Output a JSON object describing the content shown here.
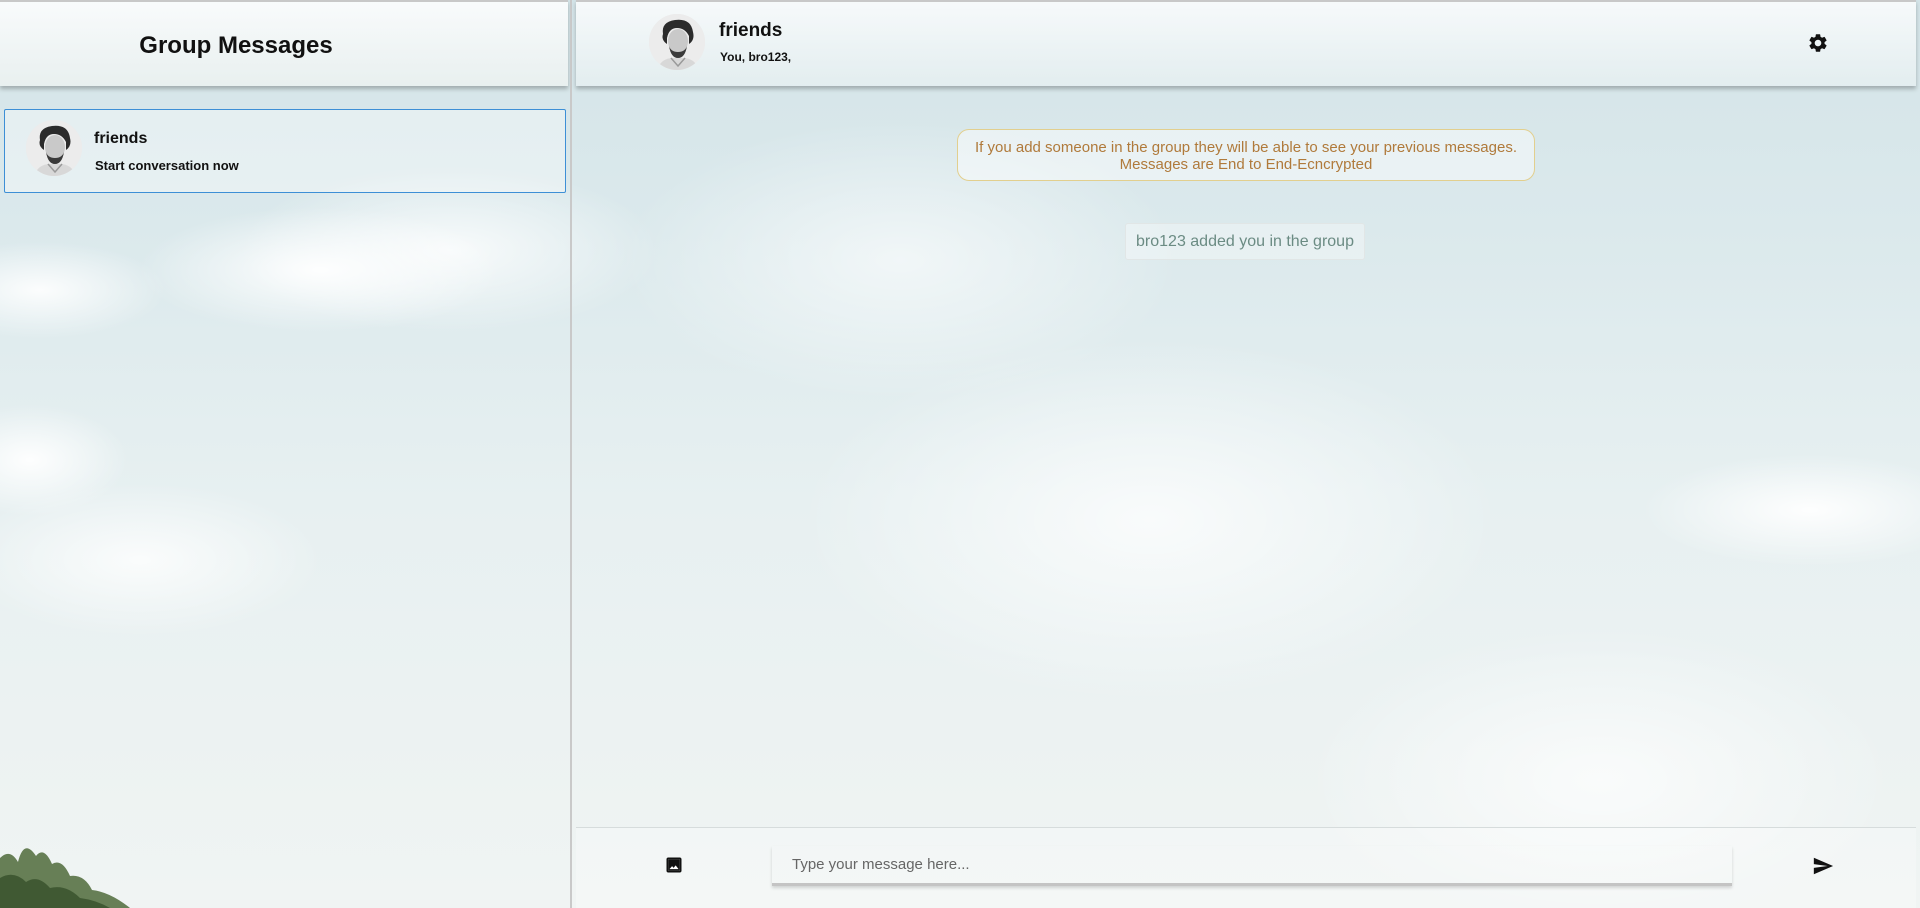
{
  "sidebar": {
    "title": "Group Messages",
    "chats": [
      {
        "name": "friends",
        "subtitle": "Start conversation now",
        "avatar": "person-portrait"
      }
    ]
  },
  "conversation": {
    "group_name": "friends",
    "members": "You, bro123,",
    "avatar": "person-portrait",
    "settings_icon": "gear-icon",
    "notice_line1": "If you add someone in the group they will be able to see your previous messages.",
    "notice_line2": "Messages are End to End-Ecncrypted",
    "system_message": "bro123 added you in the group"
  },
  "composer": {
    "placeholder": "Type your message here...",
    "image_icon": "image-icon",
    "send_icon": "send-icon"
  },
  "colors": {
    "selected_border": "#3d8fd6",
    "notice_text": "#b07a3b",
    "notice_border": "#e2cf8e",
    "system_text": "#6b8b83"
  }
}
